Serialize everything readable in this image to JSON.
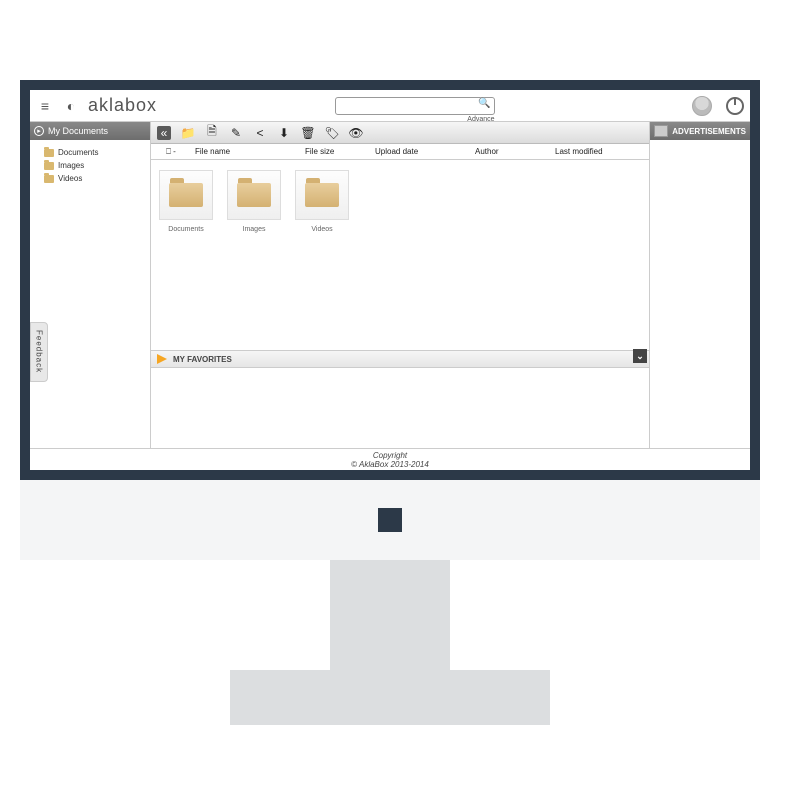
{
  "header": {
    "brand": "aklabox",
    "search_placeholder": "",
    "advance_label": "Advance"
  },
  "sidebar": {
    "title": "My Documents",
    "items": [
      {
        "label": "Documents"
      },
      {
        "label": "Images"
      },
      {
        "label": "Videos"
      }
    ]
  },
  "toolbar": {
    "icons": [
      "collapse",
      "add-folder",
      "new-doc",
      "edit",
      "share",
      "download",
      "delete",
      "tag",
      "visibility"
    ]
  },
  "table": {
    "columns": {
      "select": "⎕ -",
      "name": "File name",
      "size": "File size",
      "upload": "Upload date",
      "author": "Author",
      "modified": "Last modified"
    }
  },
  "folders": [
    {
      "label": "Documents"
    },
    {
      "label": "Images"
    },
    {
      "label": "Videos"
    }
  ],
  "favorites": {
    "title": "MY FAVORITES"
  },
  "ads": {
    "title": "ADVERTISEMENTS"
  },
  "footer": {
    "line1": "Copyright",
    "line2": "© AklaBox 2013-2014"
  },
  "feedback": {
    "label": "Feedback"
  }
}
